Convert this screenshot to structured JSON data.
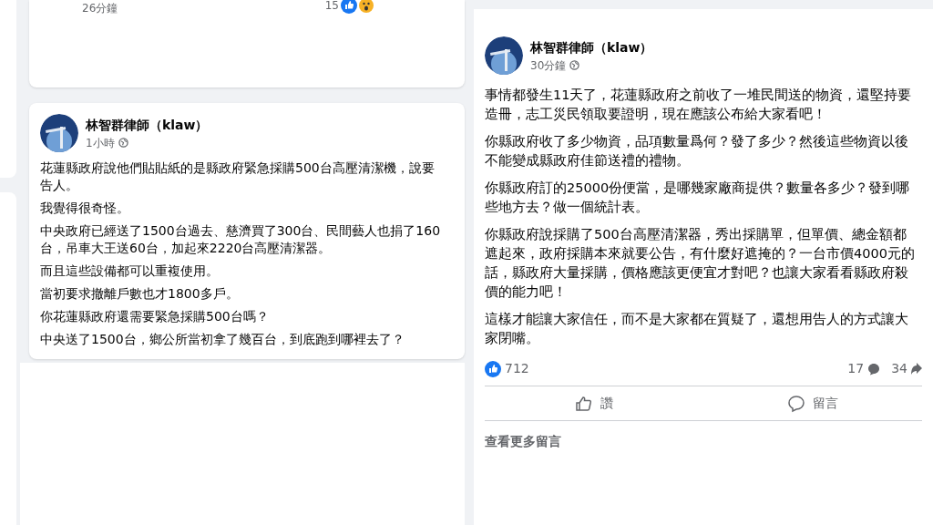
{
  "top_card": {
    "time": "26分鐘",
    "reaction_count": "15"
  },
  "left_post": {
    "author": "林智群律師（klaw）",
    "time": "1小時",
    "paragraphs": [
      "花蓮縣政府說他們貼貼紙的是縣政府緊急採購500台高壓清潔機，說要告人。",
      "我覺得很奇怪。",
      "中央政府已經送了1500台過去、慈濟買了300台、民間藝人也捐了160台，吊車大王送60台，加起來2220台高壓清潔器。",
      "而且這些設備都可以重複使用。",
      "當初要求撤離戶數也才1800多戶。",
      "你花蓮縣政府還需要緊急採購500台嗎？",
      "中央送了1500台，鄉公所當初拿了幾百台，到底跑到哪裡去了？"
    ]
  },
  "right_post": {
    "author": "林智群律師（klaw）",
    "time": "30分鐘",
    "paragraphs": [
      "事情都發生11天了，花蓮縣政府之前收了一堆民間送的物資，還堅持要造冊，志工災民領取要證明，現在應該公布給大家看吧！",
      "你縣政府收了多少物資，品項數量爲何？發了多少？然後這些物資以後不能變成縣政府佳節送禮的禮物。",
      "你縣政府訂的25000份便當，是哪幾家廠商提供？數量各多少？發到哪些地方去？做一個統計表。",
      "你縣政府說採購了500台高壓清潔器，秀出採購單，但單價、總金額都遮起來，政府採購本來就要公告，有什麼好遮掩的？一台市價4000元的話，縣政府大量採購，價格應該更便宜才對吧？也讓大家看看縣政府殺價的能力吧！",
      "這樣才能讓大家信任，而不是大家都在質疑了，還想用告人的方式讓大家閉嘴。"
    ],
    "likes": "712",
    "comments": "17",
    "shares": "34",
    "actions": [
      {
        "kind": "like",
        "label": "讚"
      },
      {
        "kind": "comment",
        "label": "留言"
      }
    ],
    "more_comments": "查看更多留言"
  }
}
